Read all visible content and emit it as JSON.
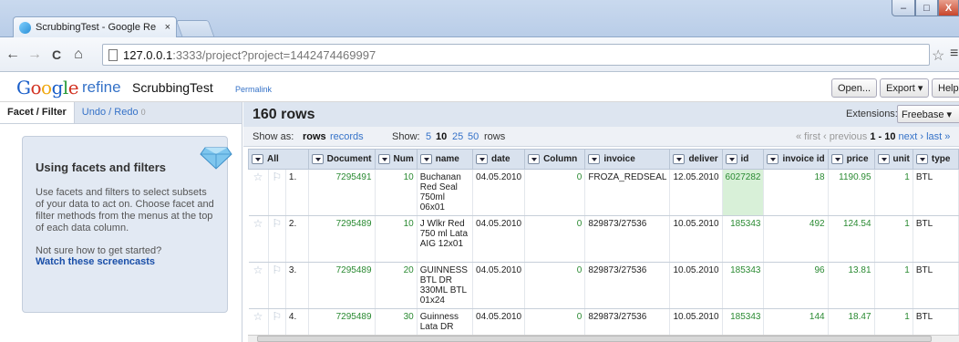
{
  "browser": {
    "tab_title": "ScrubbingTest - Google Re",
    "tab_close": "×",
    "url_host": "127.0.0.1",
    "url_rest": ":3333/project?project=1442474469997",
    "back": "←",
    "forward": "→",
    "reload": "C",
    "home": "⌂",
    "star": "☆",
    "menu": "≡",
    "min": "–",
    "max": "□",
    "close": "X"
  },
  "header": {
    "logo_refine": "refine",
    "project_name": "ScrubbingTest",
    "permalink": "Permalink",
    "open_label": "Open...",
    "export_label": "Export ▾",
    "help_label": "Help"
  },
  "left_panel": {
    "tab_facet": "Facet / Filter",
    "tab_undo": "Undo / Redo",
    "undo_count": "0",
    "help_title": "Using facets and filters",
    "help_text": "Use facets and filters to select subsets of your data to act on. Choose facet and filter methods from the menus at the top of each data column.",
    "help_question": "Not sure how to get started?",
    "help_link": "Watch these screencasts"
  },
  "right_panel": {
    "row_count": "160 rows",
    "extensions_label": "Extensions:",
    "extensions_value": "Freebase ▾",
    "show_as_label": "Show as:",
    "show_rows": "rows",
    "show_records": "records",
    "show_label": "Show:",
    "show_5": "5",
    "show_10": "10",
    "show_25": "25",
    "show_50": "50",
    "show_rows_word": "rows",
    "pager_first": "« first",
    "pager_prev": "‹ previous",
    "pager_range": "1 - 10",
    "pager_next": "next ›",
    "pager_last": "last »"
  },
  "table": {
    "columns": [
      "All",
      "Document",
      "Num",
      "name",
      "date",
      "Column",
      "invoice",
      "deliver",
      "id",
      "invoice id",
      "price",
      "unit",
      "type"
    ],
    "rows": [
      {
        "idx": "1.",
        "document": "7295491",
        "num": "10",
        "name": "Buchanan Red Seal 750ml 06x01",
        "date": "04.05.2010",
        "column": "0",
        "invoice": "FROZA_REDSEAL",
        "deliver": "12.05.2010",
        "id": "6027282",
        "invoice_id": "18",
        "price": "1190.95",
        "unit": "1",
        "type": "BTL"
      },
      {
        "idx": "2.",
        "document": "7295489",
        "num": "10",
        "name": "J Wlkr Red 750 ml Lata AIG 12x01",
        "date": "04.05.2010",
        "column": "0",
        "invoice": "829873/27536",
        "deliver": "10.05.2010",
        "id": "185343",
        "invoice_id": "492",
        "price": "124.54",
        "unit": "1",
        "type": "BTL"
      },
      {
        "idx": "3.",
        "document": "7295489",
        "num": "20",
        "name": "GUINNESS BTL DR 330ML BTL 01x24",
        "date": "04.05.2010",
        "column": "0",
        "invoice": "829873/27536",
        "deliver": "10.05.2010",
        "id": "185343",
        "invoice_id": "96",
        "price": "13.81",
        "unit": "1",
        "type": "BTL"
      },
      {
        "idx": "4.",
        "document": "7295489",
        "num": "30",
        "name": "Guinness Lata DR",
        "date": "04.05.2010",
        "column": "0",
        "invoice": "829873/27536",
        "deliver": "10.05.2010",
        "id": "185343",
        "invoice_id": "144",
        "price": "18.47",
        "unit": "1",
        "type": "BTL"
      }
    ]
  },
  "scrollbar_label": "III"
}
